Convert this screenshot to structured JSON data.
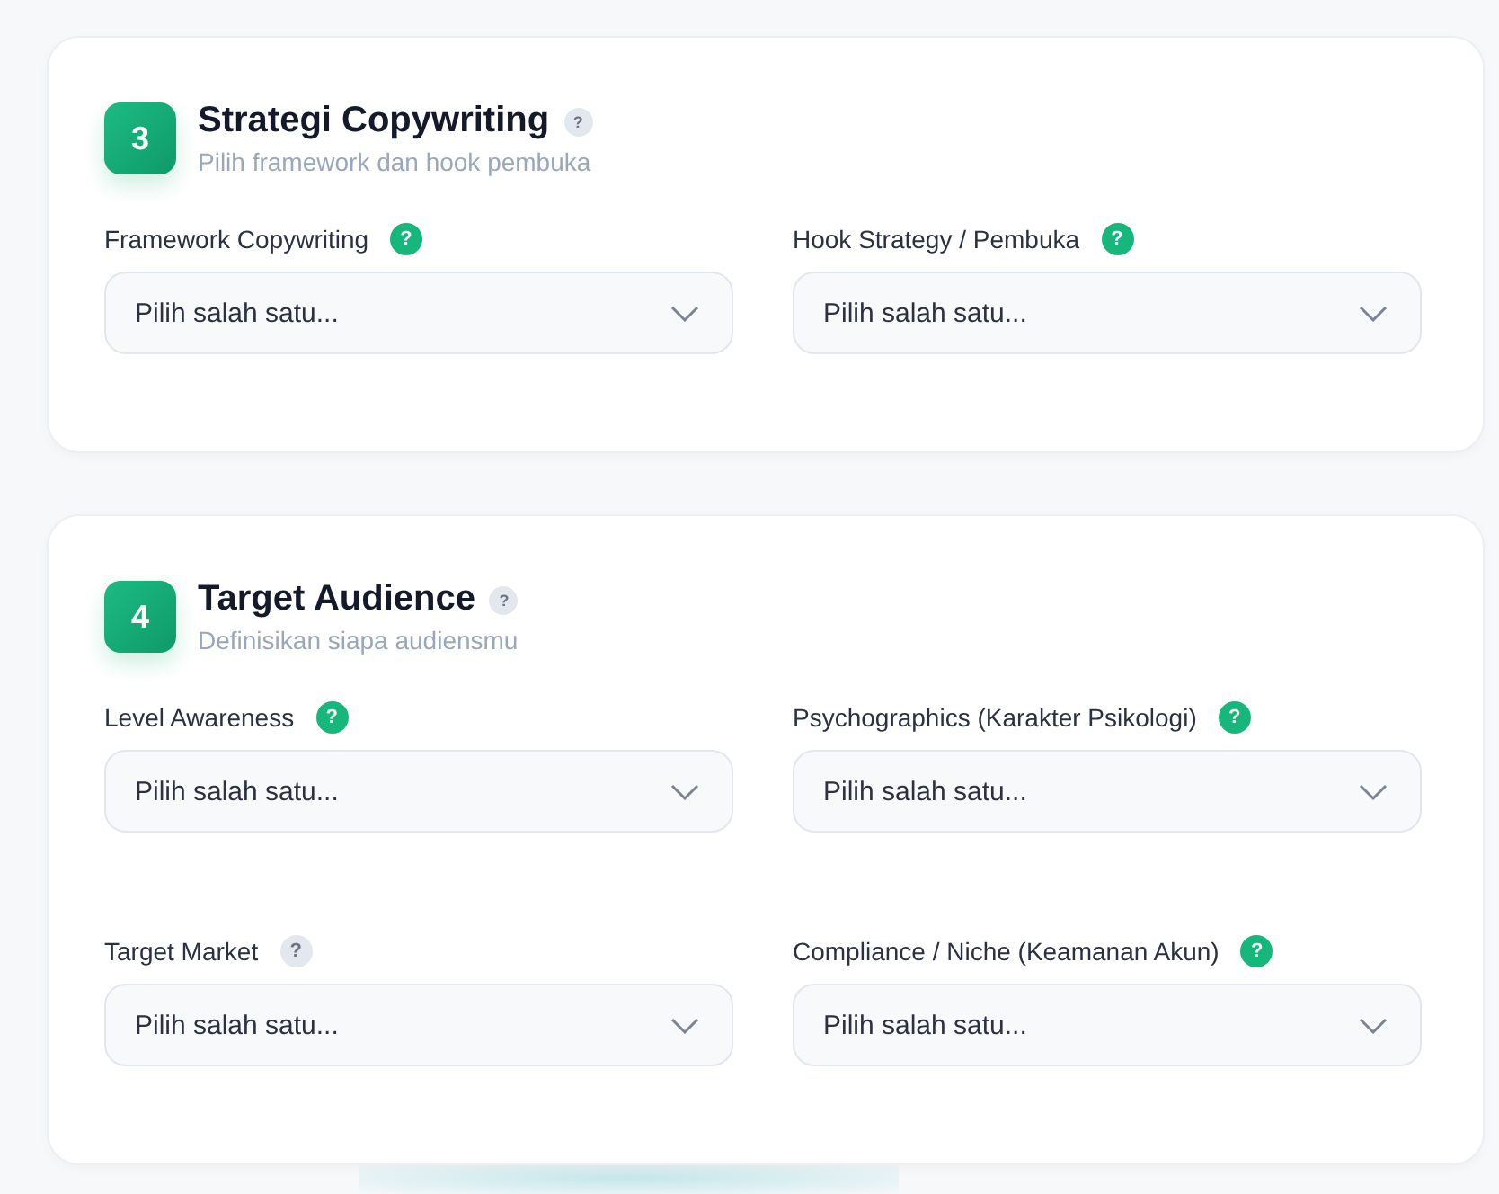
{
  "sections": [
    {
      "number": "3",
      "title": "Strategi Copywriting",
      "subtitle": "Pilih framework dan hook pembuka",
      "help": {
        "text": "?",
        "color": "#e3e7ee"
      },
      "fields": [
        {
          "label": "Framework Copywriting",
          "help": {
            "text": "?",
            "color": "#17b77c"
          },
          "placeholder": "Pilih salah satu..."
        },
        {
          "label": "Hook Strategy / Pembuka",
          "help": {
            "text": "?",
            "color": "#17b77c"
          },
          "placeholder": "Pilih salah satu..."
        }
      ]
    },
    {
      "number": "4",
      "title": "Target Audience",
      "subtitle": "Definisikan siapa audiensmu",
      "help": {
        "text": "?",
        "color": "#e3e7ee"
      },
      "fields": [
        {
          "label": "Level Awareness",
          "help": {
            "text": "?",
            "color": "#17b77c"
          },
          "placeholder": "Pilih salah satu..."
        },
        {
          "label": "Psychographics (Karakter Psikologi)",
          "help": {
            "text": "?",
            "color": "#17b77c"
          },
          "placeholder": "Pilih salah satu..."
        },
        {
          "label": "Target Market",
          "help": {
            "text": "?",
            "color": "#e3e7ee"
          },
          "placeholder": "Pilih salah satu..."
        },
        {
          "label": "Compliance / Niche (Keamanan Akun)",
          "help": {
            "text": "?",
            "color": "#17b77c"
          },
          "placeholder": "Pilih salah satu..."
        }
      ]
    }
  ]
}
